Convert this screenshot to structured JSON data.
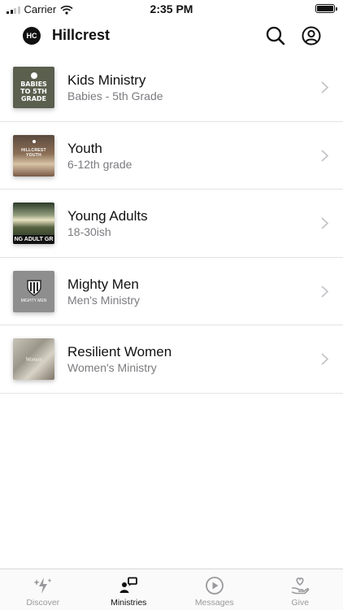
{
  "status_bar": {
    "carrier": "Carrier",
    "time": "2:35 PM"
  },
  "header": {
    "logo_text": "HC",
    "title": "Hillcrest"
  },
  "ministries": [
    {
      "title": "Kids Ministry",
      "subtitle": "Babies - 5th Grade",
      "thumb_text": "BABIES TO 5TH GRADE"
    },
    {
      "title": "Youth",
      "subtitle": "6-12th grade",
      "thumb_text": "HILLCREST YOUTH"
    },
    {
      "title": "Young Adults",
      "subtitle": "18-30ish",
      "thumb_text": "NG ADULT GR"
    },
    {
      "title": "Mighty Men",
      "subtitle": "Men's Ministry",
      "thumb_text": "MIGHTY MEN"
    },
    {
      "title": "Resilient Women",
      "subtitle": "Women's Ministry",
      "thumb_text": "Women"
    }
  ],
  "tabs": [
    {
      "label": "Discover",
      "icon": "sparkle-bolt-icon",
      "active": false
    },
    {
      "label": "Ministries",
      "icon": "ministries-icon",
      "active": true
    },
    {
      "label": "Messages",
      "icon": "play-circle-icon",
      "active": false
    },
    {
      "label": "Give",
      "icon": "hand-heart-icon",
      "active": false
    }
  ],
  "colors": {
    "accent": "#111111",
    "inactive_tab": "#9a9a9e",
    "subtitle": "#7b7b80",
    "separator": "#e3e3e6"
  }
}
